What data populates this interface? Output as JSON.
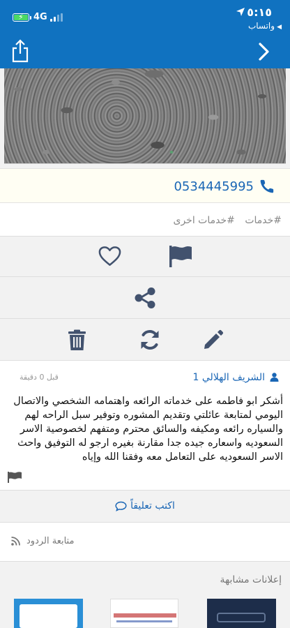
{
  "status_bar": {
    "time": "٥:١٥",
    "back_app_label": "واتساب",
    "network": "4G"
  },
  "contact": {
    "phone": "0534445995"
  },
  "tags": [
    "#خدمات",
    "#خدمات اخرى"
  ],
  "comment": {
    "author": "الشريف الهلالي 1",
    "time": "قبل 0 دقيقة",
    "text": "أشكر ابو فاطمه على خدماته الرائعه واهتمامه الشخصي والاتصال اليومي لمتابعة عائلتي وتقديم المشوره وتوفير سبل الراحه لهم والسياره رائعه ومكيفه والسائق محترم ومتفهم لخصوصية الاسر السعوديه واسعاره جيده جدا مقارنة بغيره ارجو له التوفيق واحث الاسر السعوديه على التعامل معه وفقنا الله وإياه"
  },
  "write_comment_label": "اكتب تعليقاً",
  "follow_label": "متابعة الردود",
  "similar_ads_title": "إعلانات مشابهة",
  "colors": {
    "header": "#1072c0",
    "link": "#1a66b5",
    "icon": "#42526e"
  }
}
